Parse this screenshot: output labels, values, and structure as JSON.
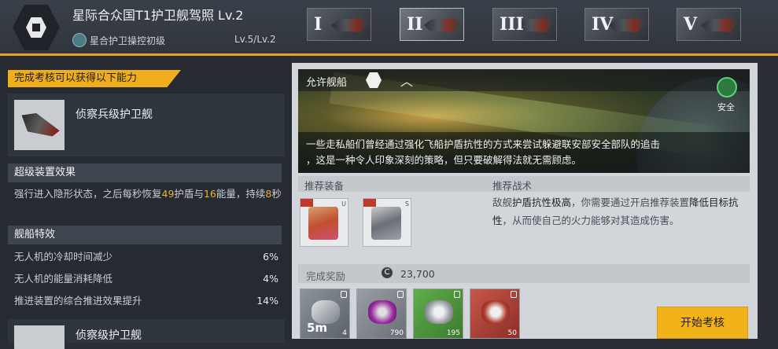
{
  "header": {
    "title": "星际合众国T1护卫舰驾照 Lv.2",
    "skill_label": "星合护卫操控初级",
    "skill_level": "Lv.5/Lv.2",
    "tiers": [
      "I",
      "II",
      "III",
      "IV",
      "V"
    ],
    "active_tier": "II"
  },
  "left": {
    "banner": "完成考核可以获得以下能力",
    "ship_name": "侦察兵级护卫舰",
    "super_equip_heading": "超级装置效果",
    "super_equip_desc": {
      "p1": "强行进入隐形状态，之后每秒恢复",
      "v1": "49",
      "p2": "护盾与",
      "v2": "16",
      "p3": "能量，持续",
      "v3": "8",
      "p4": "秒"
    },
    "ship_traits_heading": "舰船特效",
    "traits": [
      {
        "label": "无人机的冷却时间减少",
        "value": "6%"
      },
      {
        "label": "无人机的能量消耗降低",
        "value": "4%"
      },
      {
        "label": "推进装置的综合推进效果提升",
        "value": "14%"
      }
    ],
    "next_ship_name": "侦察级护卫舰"
  },
  "right": {
    "allowed_label": "允许舰船",
    "safe_label": "安全",
    "description_line1": "一些走私船们曾经通过强化飞船护盾抗性的方式来尝试躲避联安部安全部队的追击",
    "description_line2": "，这是一种令人印象深刻的策略，但只要破解得法就无需顾虑。",
    "rec_equip_label": "推荐装备",
    "rec_tactic_label": "推荐战术",
    "equip_badges": [
      "U",
      "S"
    ],
    "tactic": {
      "p1": "敌舰",
      "b1": "护盾抗性极高",
      "p2": "，你需要通过开启推荐装置",
      "b2": "降低目标抗性",
      "p3": "，从而使自己的火力能够对其造成伤害。"
    },
    "reward_label": "完成奖励",
    "coin_symbol": "C",
    "coin_value": "23,700",
    "rewards": [
      {
        "icon": "boost-item",
        "big": "5m",
        "qty": "4"
      },
      {
        "icon": "purple-ore",
        "big": "",
        "qty": "790"
      },
      {
        "icon": "green-ore",
        "big": "",
        "qty": "195"
      },
      {
        "icon": "red-ore",
        "big": "",
        "qty": "50"
      }
    ],
    "start_button": "开始考核"
  }
}
